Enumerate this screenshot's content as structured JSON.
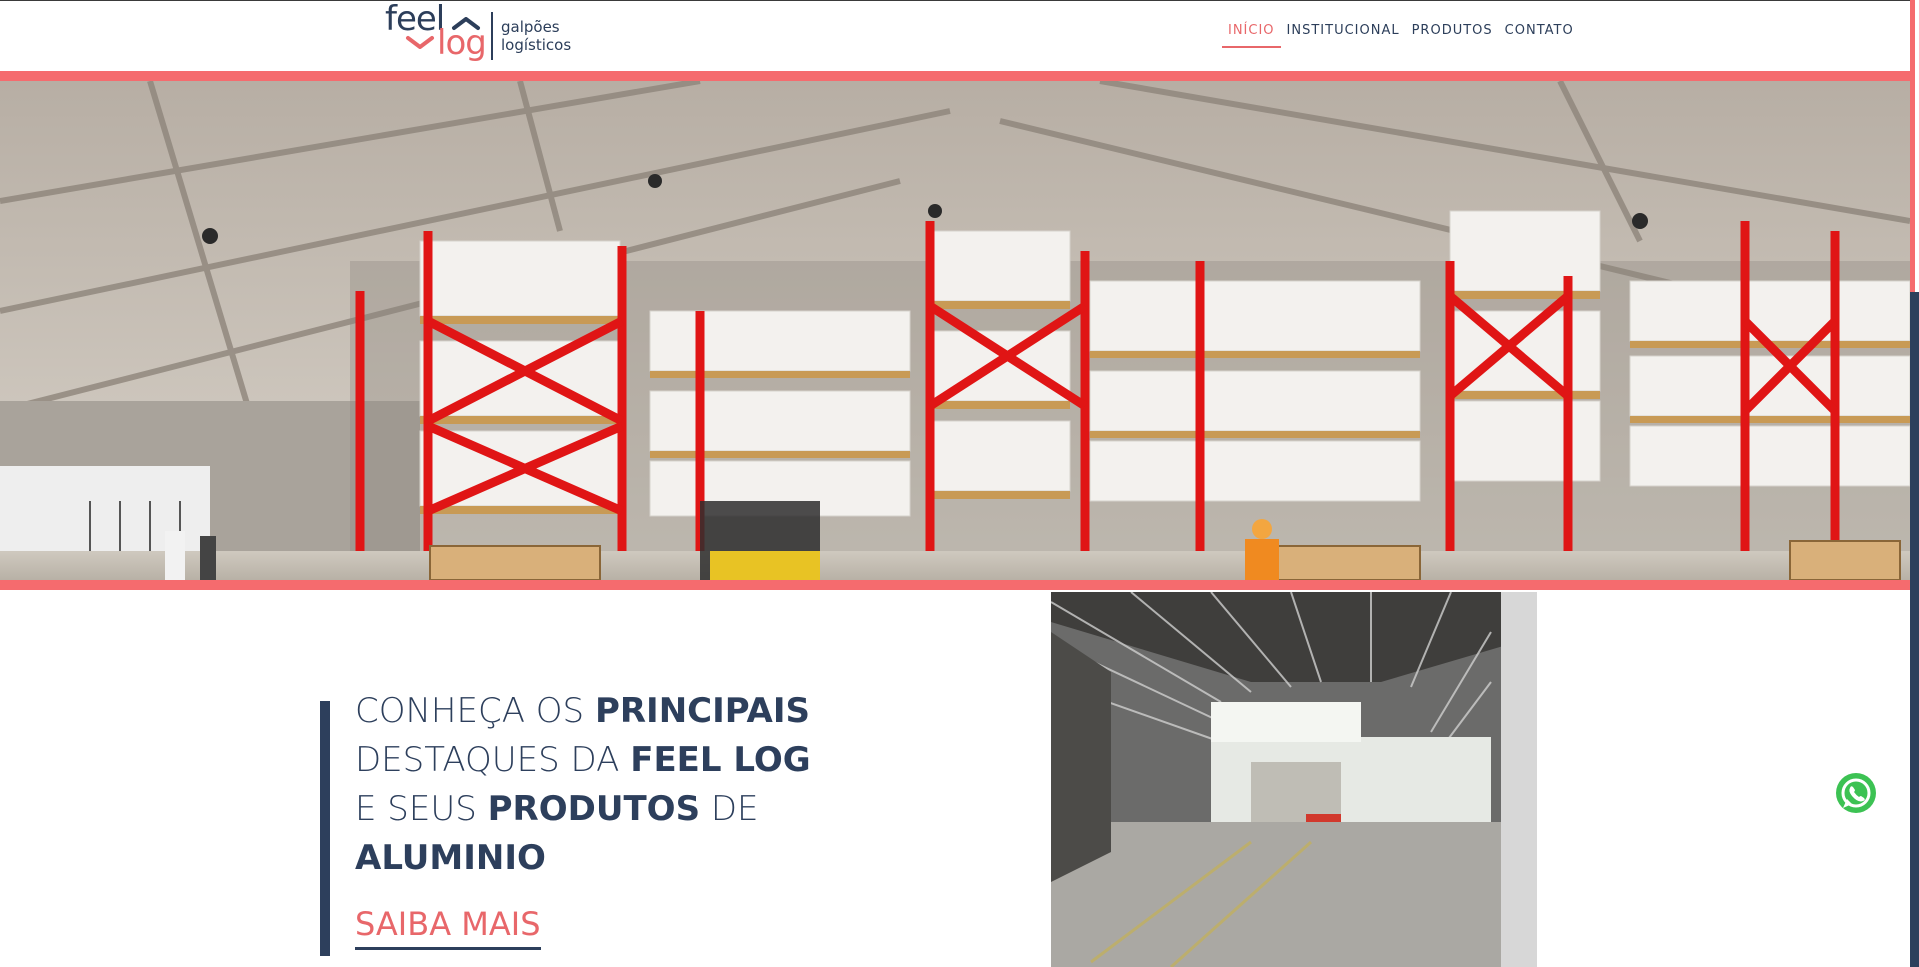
{
  "brand": {
    "feel": "feel",
    "log": "log",
    "subtitle_line1": "galpões",
    "subtitle_line2": "logísticos"
  },
  "nav": {
    "items": [
      {
        "label": "INÍCIO",
        "active": true
      },
      {
        "label": "INSTITUCIONAL",
        "active": false
      },
      {
        "label": "PRODUTOS",
        "active": false
      },
      {
        "label": "CONTATO",
        "active": false
      }
    ]
  },
  "slider": {
    "dot_count": 3,
    "active_dot": 3,
    "images": [
      "warehouse-racks-render"
    ]
  },
  "highlight": {
    "line1_light": "CONHEÇA OS ",
    "line1_bold": "PRINCIPAIS",
    "line2_light": "DESTAQUES DA ",
    "line2_bold": "FEEL LOG",
    "line3_light_a": "E SEUS ",
    "line3_bold": "PRODUTOS",
    "line3_light_b": " DE",
    "line4_bold": "ALUMINIO",
    "cta": "SAIBA MAIS"
  },
  "floating": {
    "whatsapp_icon": "whatsapp-icon"
  },
  "colors": {
    "accent": "#e8676a",
    "band_red": "#f56b6e",
    "navy": "#2d3f5c"
  }
}
